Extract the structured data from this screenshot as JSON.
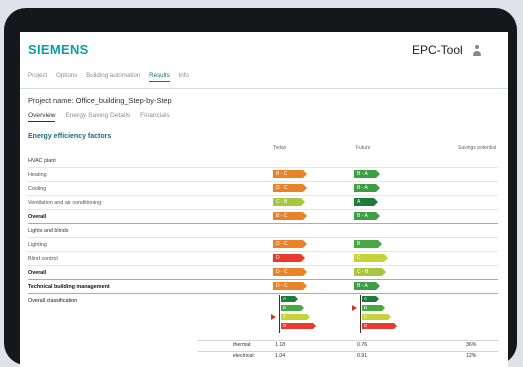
{
  "header": {
    "brand": "SIEMENS",
    "app_title": "EPC-Tool"
  },
  "nav": {
    "items": [
      "Project",
      "Options",
      "Building automation",
      "Results",
      "Info"
    ],
    "active_index": 3
  },
  "project": {
    "label": "Project name: Office_building_Step-by-Step"
  },
  "subnav": {
    "items": [
      "Overview",
      "Energy Saving Details",
      "Financials"
    ],
    "active_index": 0
  },
  "section": {
    "title": "Energy efficiency factors"
  },
  "columns": {
    "today": "Today",
    "future": "Future",
    "savings": "Savings potential"
  },
  "rows": [
    {
      "label": "HVAC plant",
      "type": "group"
    },
    {
      "label": "Heating",
      "today": "B - C",
      "future": "B - A"
    },
    {
      "label": "Cooling",
      "today": "D - C",
      "future": "B - A"
    },
    {
      "label": "Ventilation and air conditioning",
      "today": "C - B",
      "future": "A"
    },
    {
      "label": "Overall",
      "type": "bold",
      "today": "B - C",
      "future": "B - A"
    },
    {
      "label": "Lights and blinds",
      "type": "group"
    },
    {
      "label": "Lighting",
      "today": "D - C",
      "future": "B"
    },
    {
      "label": "Blind control",
      "today": "D",
      "future": "C"
    },
    {
      "label": "Overall",
      "type": "bold",
      "today": "D - C",
      "future": "C - B"
    },
    {
      "label": "Technical building management",
      "type": "bold",
      "today": "D - C",
      "future": "B - A"
    }
  ],
  "overall": {
    "label": "Overall classification",
    "scale": [
      "A",
      "B",
      "C",
      "D"
    ],
    "today_marker": "C",
    "future_marker": "B"
  },
  "summary": [
    {
      "label": "thermal:",
      "today": "1.18",
      "future": "0.76",
      "savings": "36%"
    },
    {
      "label": "electrical:",
      "today": "1.04",
      "future": "0.91",
      "savings": "12%"
    }
  ],
  "colors": {
    "A": "#1e7b3b",
    "B": "#4aa843",
    "C": "#c5d23a",
    "D": "#e63b2e",
    "D - C": "#e8832b",
    "B - C": "#e8832b",
    "C - B": "#a6c840",
    "B - A": "#3d9e45",
    "brand": "#0b9ea6",
    "accent": "#1a6e7a"
  }
}
